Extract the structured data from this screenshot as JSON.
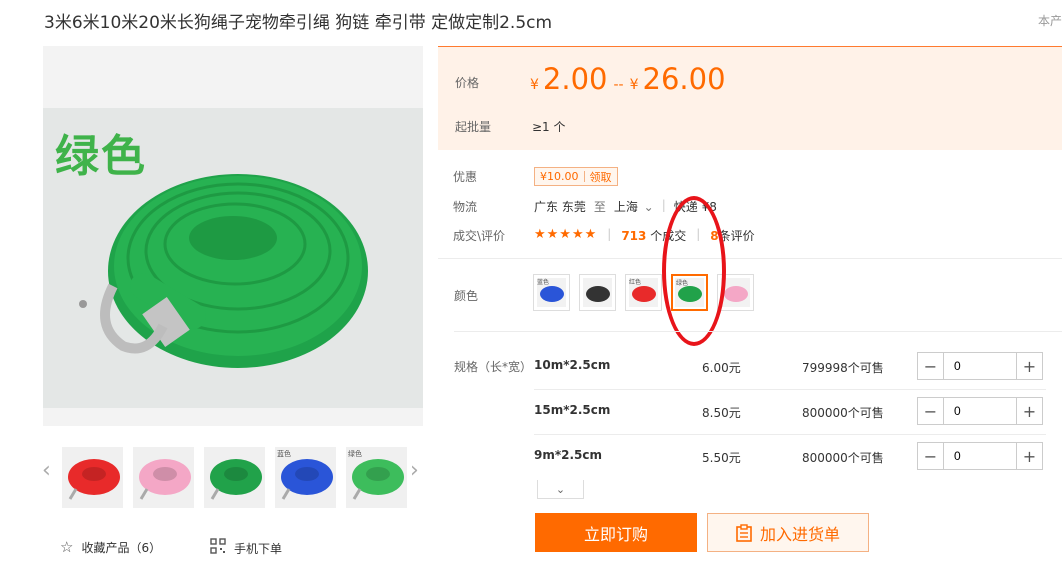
{
  "product": {
    "title": "3米6米10米20米长狗绳子宠物牵引绳 狗链 牵引带 定做定制2.5cm",
    "top_right": "本产"
  },
  "gallery": {
    "main_label": "绿色",
    "prev_icon": "chevron-left-icon",
    "next_icon": "chevron-right-icon",
    "thumbs": [
      {
        "caption": "",
        "color": "#e82a2a"
      },
      {
        "caption": "",
        "color": "#f4a7c6"
      },
      {
        "caption": "",
        "color": "#21a24a"
      },
      {
        "caption": "蓝色",
        "color": "#2a55d8"
      },
      {
        "caption": "绿色",
        "color": "#3dbd5c"
      }
    ]
  },
  "actions_left": {
    "favorite_label": "收藏产品（6）",
    "favorite_icon": "star-outline-icon",
    "mobile_label": "手机下单",
    "mobile_icon": "qrcode-icon"
  },
  "price": {
    "label": "价格",
    "currency": "¥",
    "min": "2.00",
    "separator": "--",
    "max": "26.00",
    "moq_label": "起批量",
    "moq_value": "≥1 个"
  },
  "promo": {
    "label": "优惠",
    "coupon_value": "¥10.00",
    "coupon_action": "领取"
  },
  "shipping": {
    "label": "物流",
    "from": "广东 东莞",
    "to_word": "至",
    "destination": "上海",
    "method": "快递 ¥8"
  },
  "deals": {
    "label": "成交\\评价",
    "stars": "★★★★★",
    "deal_count": "713",
    "deal_suffix": "个成交",
    "review_count": "8",
    "review_suffix": "条评价"
  },
  "colors": {
    "label": "颜色",
    "selected_index": 3,
    "swatches": [
      {
        "caption": "蓝色",
        "color": "#2a55d8"
      },
      {
        "caption": "",
        "color": "#333333"
      },
      {
        "caption": "红色",
        "color": "#e82a2a"
      },
      {
        "caption": "绿色",
        "color": "#21a24a"
      },
      {
        "caption": "",
        "color": "#f4a7c6"
      }
    ],
    "annotation_color": "#e8141a"
  },
  "specs": {
    "label": "规格（长*宽）",
    "rows": [
      {
        "name": "10m*2.5cm",
        "price": "6.00元",
        "stock": "799998个可售",
        "qty": "0"
      },
      {
        "name": "15m*2.5cm",
        "price": "8.50元",
        "stock": "800000个可售",
        "qty": "0"
      },
      {
        "name": "9m*2.5cm",
        "price": "5.50元",
        "stock": "800000个可售",
        "qty": "0"
      }
    ],
    "expand_icon": "chevron-down-icon"
  },
  "buttons": {
    "buy_now": "立即订购",
    "add_to_list": "加入进货单",
    "add_icon": "clipboard-icon"
  },
  "theme": {
    "accent": "#ff6a00",
    "price_bg": "#fff2e8"
  }
}
